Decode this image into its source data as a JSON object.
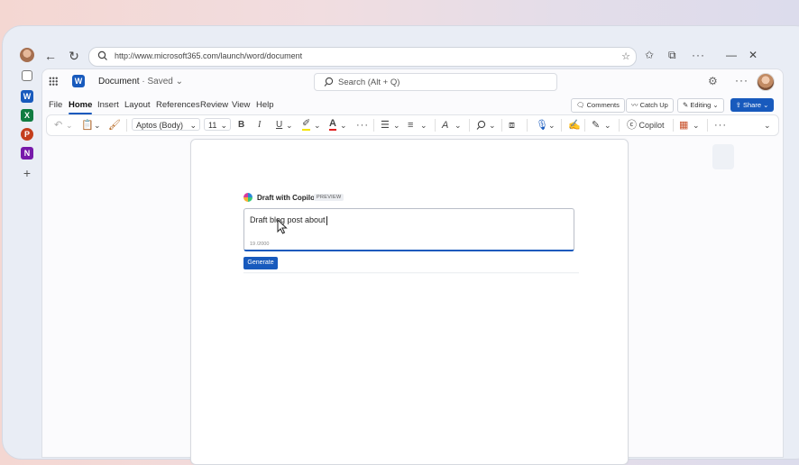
{
  "browser": {
    "url": "http://www.microsoft365.com/launch/word/document"
  },
  "app": {
    "doc_name": "Document",
    "doc_status": "· Saved ⌄",
    "search_placeholder": "Search (Alt + Q)",
    "menus": [
      "File",
      "Home",
      "Insert",
      "Layout",
      "References",
      "Review",
      "View",
      "Help"
    ],
    "active_menu": "Home",
    "buttons": {
      "comments": "Comments",
      "catch_up": "Catch Up",
      "editing": "Editing ⌄",
      "share": "Share ⌄"
    }
  },
  "ribbon": {
    "font_name": "Aptos (Body)",
    "font_size": "11",
    "bold": "B",
    "italic": "I",
    "underline": "U",
    "copilot_label": "Copilot"
  },
  "copilot": {
    "title": "Draft with Copilot",
    "badge": "PREVIEW",
    "input_text": "Draft blog post about",
    "char_count": "19 /2000",
    "generate_label": "Generate"
  },
  "colors": {
    "accent": "#185abd",
    "excel": "#107c41",
    "powerpoint": "#c43e1c",
    "onenote": "#7719aa"
  }
}
